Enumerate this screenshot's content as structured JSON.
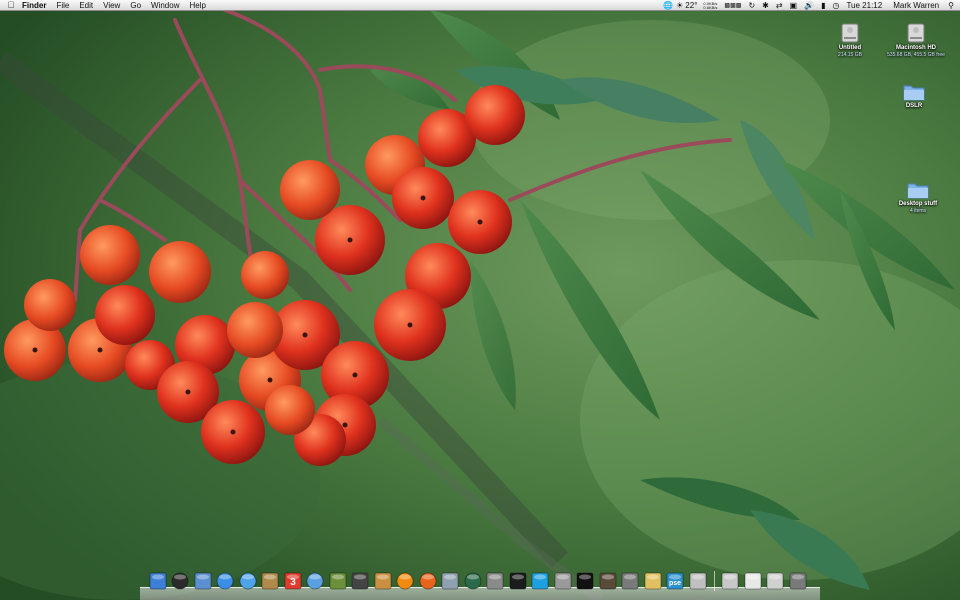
{
  "menubar": {
    "app_name": "Finder",
    "menus": [
      "File",
      "Edit",
      "View",
      "Go",
      "Window",
      "Help"
    ],
    "status": {
      "temperature": "22°",
      "net_up": "0.0KB/s",
      "net_down": "0.6KB/s",
      "clock": "Tue 21:12",
      "user": "Mark Warren"
    }
  },
  "desktop_icons": [
    {
      "label": "Untitled",
      "sub": "214.15 GB",
      "icon": "hard-drive-icon"
    },
    {
      "label": "Macintosh HD",
      "sub": "535.68 GB, 455.5 GB free",
      "icon": "hard-drive-icon"
    },
    {
      "label": "DSLR",
      "sub": "",
      "icon": "folder-icon"
    },
    {
      "label": "Desktop stuff",
      "sub": "4 items",
      "icon": "folder-icon"
    }
  ],
  "dock": {
    "apps": [
      {
        "name": "finder-icon",
        "color": "#3d7fd6"
      },
      {
        "name": "dashboard-icon",
        "color": "#2b2b2b"
      },
      {
        "name": "mail-icon",
        "color": "#5a8fd0"
      },
      {
        "name": "safari-icon",
        "color": "#3a8ee6"
      },
      {
        "name": "ichat-icon",
        "color": "#4fa3e8"
      },
      {
        "name": "address-book-icon",
        "color": "#b08a4a"
      },
      {
        "name": "ical-icon",
        "color": "#e23a2e"
      },
      {
        "name": "itunes-icon",
        "color": "#5aa0e0"
      },
      {
        "name": "iphoto-icon",
        "color": "#6b8f3a"
      },
      {
        "name": "imovie-icon",
        "color": "#444444"
      },
      {
        "name": "garageband-icon",
        "color": "#c89040"
      },
      {
        "name": "vlc-icon",
        "color": "#f08a10"
      },
      {
        "name": "firefox-icon",
        "color": "#e8641c"
      },
      {
        "name": "preview-icon",
        "color": "#8fa0b0"
      },
      {
        "name": "time-machine-icon",
        "color": "#2a6a4a"
      },
      {
        "name": "system-preferences-icon",
        "color": "#8a8a8a"
      },
      {
        "name": "activity-monitor-icon",
        "color": "#1c1c1c"
      },
      {
        "name": "skype-icon",
        "color": "#1ea0e0"
      },
      {
        "name": "disk-utility-icon",
        "color": "#9a9a9a"
      },
      {
        "name": "terminal-icon",
        "color": "#111111"
      },
      {
        "name": "photoshop-icon",
        "color": "#5a4a3a"
      },
      {
        "name": "printer-icon",
        "color": "#7a7a7a"
      },
      {
        "name": "textedit-icon",
        "color": "#e0c060"
      },
      {
        "name": "photoshop-elements-icon",
        "color": "#2a90d0"
      },
      {
        "name": "image-capture-icon",
        "color": "#c0c0c0"
      }
    ],
    "photoshop_elements_label": "pse",
    "ical_date": "3",
    "stacks": [
      {
        "name": "applications-stack-icon",
        "color": "#c8c8c8"
      },
      {
        "name": "documents-stack-icon",
        "color": "#e8e8e8"
      },
      {
        "name": "downloads-stack-icon",
        "color": "#d0d0d0"
      },
      {
        "name": "trash-icon",
        "color": "#7a7a7a"
      }
    ]
  }
}
